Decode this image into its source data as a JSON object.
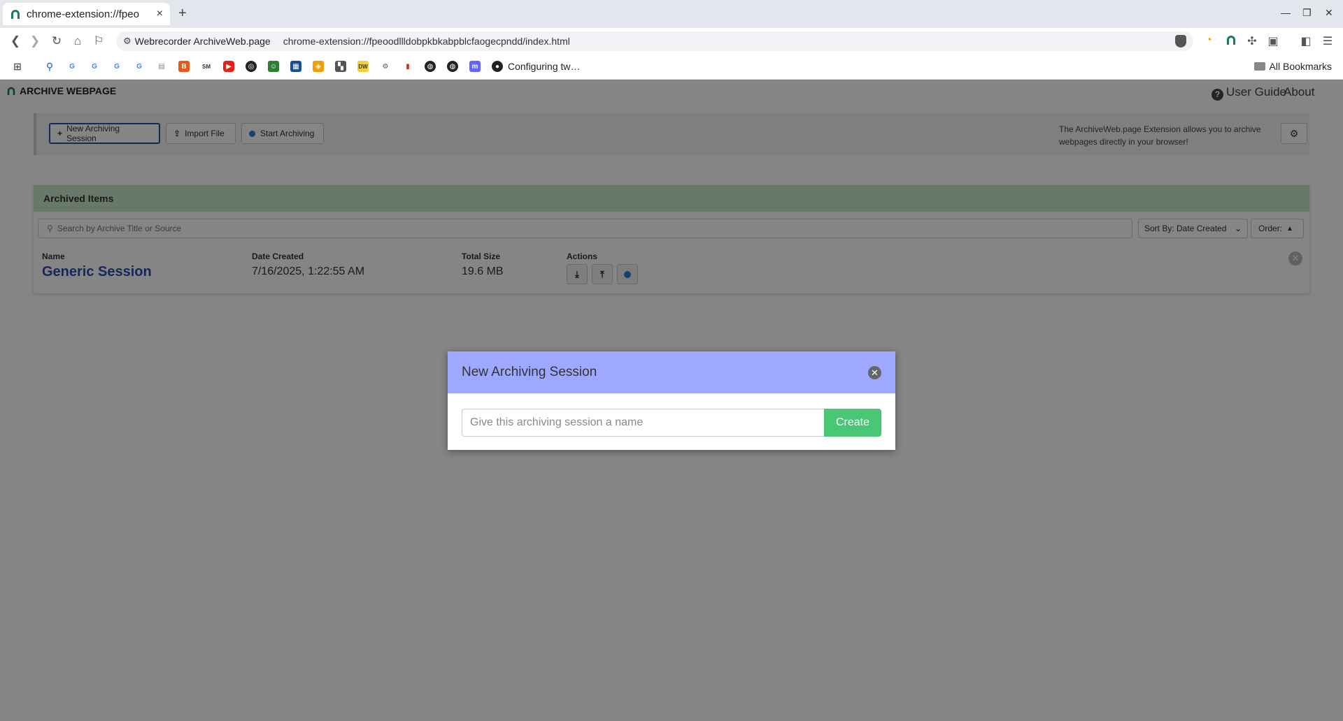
{
  "browser": {
    "tab_title": "chrome-extension://fpeo",
    "tab_close": "×",
    "new_tab": "+",
    "site_name": "Webrecorder ArchiveWeb.page",
    "url": "chrome-extension://fpeoodllldobpkbkabpblcfaogecpndd/index.html",
    "bookmark_text": "Configuring tw…",
    "all_bookmarks": "All Bookmarks"
  },
  "app": {
    "logo_text": "ARCHIVE WEBPAGE",
    "user_guide": "User Guide",
    "about": "About",
    "btn_new_session": "New Archiving Session",
    "btn_import": "Import File",
    "btn_start": "Start Archiving",
    "extension_note": "The ArchiveWeb.page Extension allows you to archive webpages directly in your browser!"
  },
  "archived": {
    "heading": "Archived Items",
    "search_placeholder": "Search by Archive Title or Source",
    "sort_label": "Sort By: Date Created",
    "order_label": "Order:",
    "columns": {
      "name": "Name",
      "date": "Date Created",
      "size": "Total Size",
      "actions": "Actions"
    },
    "row": {
      "name": "Generic Session",
      "date": "7/16/2025, 1:22:55 AM",
      "size": "19.6 MB"
    }
  },
  "modal": {
    "title": "New Archiving Session",
    "input_placeholder": "Give this archiving session a name",
    "input_value": "",
    "create_label": "Create"
  },
  "colors": {
    "modal_header": "#9ea8ff",
    "create_button": "#48c774",
    "archived_header": "#c8e6c9",
    "link_blue": "#2d4ea8",
    "record_dot": "#2b7bd8"
  }
}
